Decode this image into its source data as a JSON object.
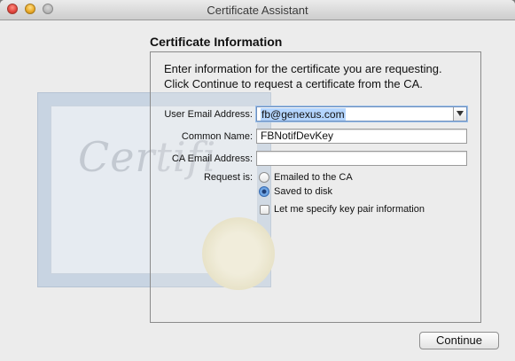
{
  "window": {
    "title": "Certificate Assistant"
  },
  "background_art": {
    "word": "Certifi"
  },
  "section": {
    "title": "Certificate Information"
  },
  "intro": {
    "line1": "Enter information for the certificate you are requesting.",
    "line2": "Click Continue to request a certificate from the CA."
  },
  "form": {
    "user_email": {
      "label": "User Email Address:",
      "value": "fb@genexus.com"
    },
    "common_name": {
      "label": "Common Name:",
      "value": "FBNotifDevKey"
    },
    "ca_email": {
      "label": "CA Email Address:",
      "value": ""
    },
    "request": {
      "label": "Request is:",
      "options": [
        {
          "label": "Emailed to the CA",
          "selected": false
        },
        {
          "label": "Saved to disk",
          "selected": true
        }
      ]
    },
    "key_pair": {
      "label": "Let me specify key pair information",
      "checked": false
    }
  },
  "buttons": {
    "continue": "Continue"
  },
  "colors": {
    "accent": "#4f8fdc",
    "selection": "#b4d5fe"
  }
}
